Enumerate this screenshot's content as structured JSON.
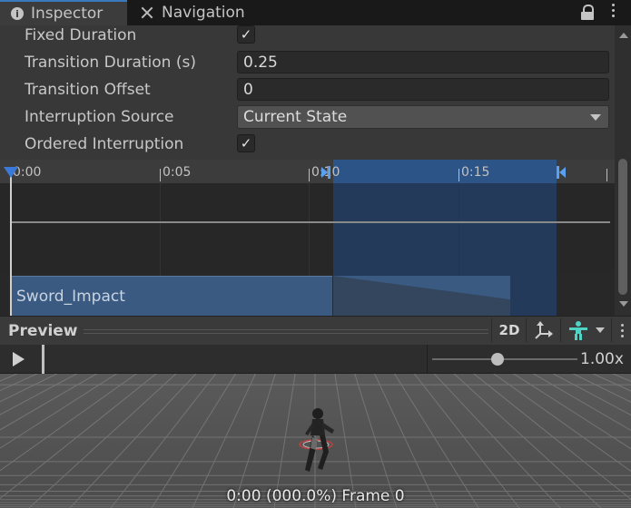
{
  "tabs": [
    {
      "label": "Inspector",
      "icon": "info-icon",
      "active": true
    },
    {
      "label": "Navigation",
      "icon": "navigation-icon",
      "active": false
    }
  ],
  "properties": {
    "fixed_duration": {
      "label": "Fixed Duration",
      "checked": true
    },
    "transition_duration": {
      "label": "Transition Duration (s)",
      "value": "0.25"
    },
    "transition_offset": {
      "label": "Transition Offset",
      "value": "0"
    },
    "interruption_source": {
      "label": "Interruption Source",
      "value": "Current State"
    },
    "ordered_interruption": {
      "label": "Ordered Interruption",
      "checked": true
    },
    "check_glyph": "✓"
  },
  "timeline": {
    "ticks": [
      "0:00",
      "0:05",
      "0:10",
      "0:15"
    ],
    "clip_name": "Sword_Impact"
  },
  "preview": {
    "title": "Preview",
    "button_2d": "2D",
    "speed": "1.00x",
    "speed_fraction": 0.45,
    "status": "0:00 (000.0%) Frame 0"
  },
  "colors": {
    "accent": "#3a79bb",
    "transition_highlight": "#2d5486",
    "clip": "#3a5a82",
    "avatar_icon": "#4fd3c4"
  }
}
